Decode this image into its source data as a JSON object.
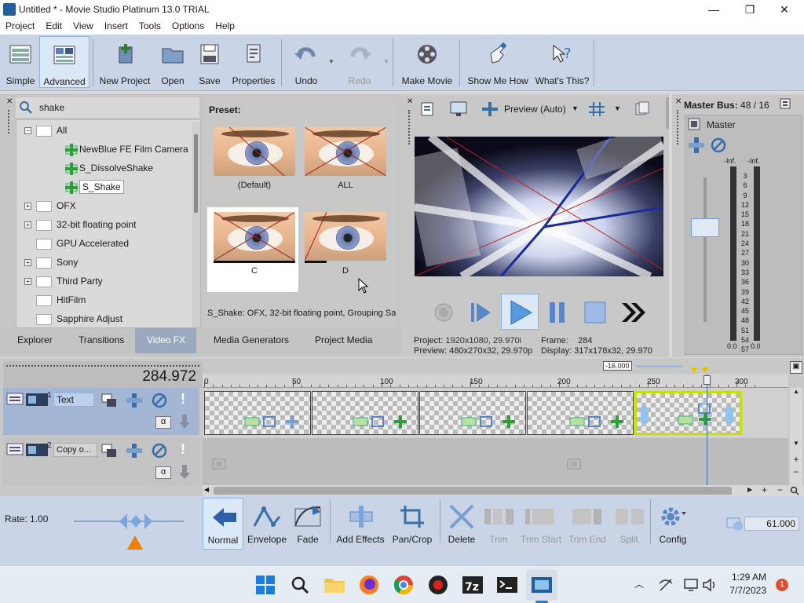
{
  "window": {
    "title": "Untitled * - Movie Studio Platinum 13.0 TRIAL",
    "minimize": "—",
    "maximize": "❐",
    "close": "✕"
  },
  "menu": [
    "Project",
    "Edit",
    "View",
    "Insert",
    "Tools",
    "Options",
    "Help"
  ],
  "toolbar": {
    "simple": "Simple",
    "advanced": "Advanced",
    "new_project": "New Project",
    "open": "Open",
    "save": "Save",
    "properties": "Properties",
    "undo": "Undo",
    "redo": "Redo",
    "make_movie": "Make Movie",
    "show_me_how": "Show Me How",
    "whats_this": "What's This?"
  },
  "search": {
    "value": "shake"
  },
  "tree": {
    "all": "All",
    "fx1": "NewBlue FE Film Camera",
    "fx2": "S_DissolveShake",
    "fx3": "S_Shake",
    "ofx": "OFX",
    "float": "32-bit floating point",
    "gpu": "GPU Accelerated",
    "sony": "Sony",
    "third": "Third Party",
    "hitfilm": "HitFilm",
    "sapphire": "Sapphire Adjust"
  },
  "preset": {
    "label": "Preset:",
    "items": [
      "(Default)",
      "ALL",
      "C",
      "D"
    ],
    "description": "S_Shake: OFX, 32-bit floating point, Grouping Sa"
  },
  "tabs": [
    "Explorer",
    "Transitions",
    "Video FX",
    "Media Generators",
    "Project Media"
  ],
  "preview": {
    "mode": "Preview (Auto)",
    "project_label": "Project:",
    "project_value": "1920x1080, 29.970i",
    "preview_label": "Preview:",
    "preview_value": "480x270x32, 29.970p",
    "frame_label": "Frame:",
    "frame_value": "284",
    "display_label": "Display:",
    "display_value": "317x178x32, 29.970"
  },
  "master": {
    "title": "Master Bus:",
    "value": "48 / 16",
    "name": "Master",
    "inf_l": "-Inf.",
    "inf_r": "-Inf.",
    "scale": [
      "3",
      "6",
      "9",
      "12",
      "15",
      "18",
      "21",
      "24",
      "27",
      "30",
      "33",
      "36",
      "39",
      "42",
      "45",
      "48",
      "51",
      "54",
      "57"
    ],
    "bottom_l": "0.0",
    "bottom_r": "0.0"
  },
  "timeline": {
    "time": "284.972",
    "zoom": "-16.000",
    "ruler": [
      "0",
      "50",
      "100",
      "150",
      "200",
      "250",
      "300"
    ],
    "track1_num": "1",
    "track1_name": "Text",
    "track2_num": "2",
    "track2_name": "Copy o...",
    "alpha": "α"
  },
  "bottom": {
    "rate": "Rate: 1.00",
    "normal": "Normal",
    "envelope": "Envelope",
    "fade": "Fade",
    "add_effects": "Add Effects",
    "pan_crop": "Pan/Crop",
    "delete": "Delete",
    "trim": "Trim",
    "trim_start": "Trim Start",
    "trim_end": "Trim End",
    "split": "Split",
    "config": "Config",
    "volume": "61.000"
  },
  "taskbar": {
    "time": "1:29 AM",
    "date": "7/7/2023",
    "notif": "1"
  },
  "colors": {
    "toolbar_bg": "#c9d5e6",
    "selection": "#8fb2de",
    "clip_border": "#c8e000",
    "playhead": "#3a6ea8"
  }
}
